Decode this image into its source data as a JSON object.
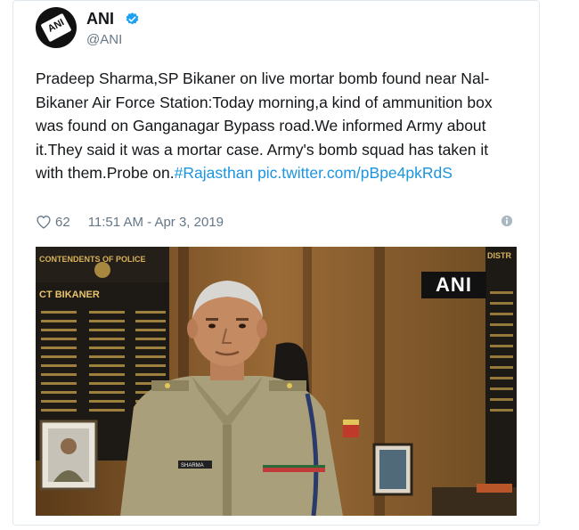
{
  "tweet": {
    "author_name": "ANI",
    "author_handle": "@ANI",
    "avatar_text": "ANI",
    "text_main": "Pradeep Sharma,SP Bikaner on live mortar bomb found near Nal-Bikaner Air Force Station:Today morning,a kind of ammunition box was found on Ganganagar Bypass road.We informed Army about it.They said it was a mortar case. Army's bomb squad has taken it with them.Probe on.",
    "hashtag": "#Rajasthan",
    "pic_link": "pic.twitter.com/pBpe4pkRdS",
    "likes": "62",
    "timestamp": "11:51 AM - Apr 3, 2019"
  },
  "video": {
    "watermark": "ANI",
    "board_left_header": "CONTENDENTS OF POLICE",
    "board_left_subheader": "CT BIKANER",
    "board_right_header": "DISTR",
    "name_plate": "SHARMA"
  },
  "colors": {
    "link": "#1b95e0",
    "verified": "#1da1f2",
    "muted": "#657786",
    "text": "#14171a"
  },
  "icons": [
    "verified-badge-icon",
    "heart-icon",
    "info-icon"
  ]
}
